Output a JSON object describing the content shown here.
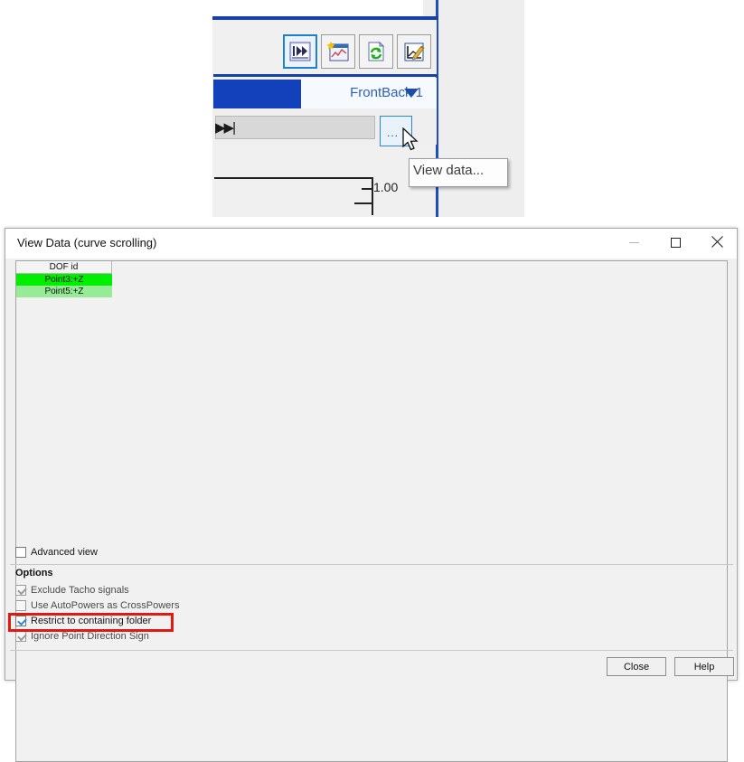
{
  "background_app": {
    "toolbar": {
      "buttons": [
        {
          "name": "fast-forward-icon",
          "label": "Fast forward",
          "selected": true
        },
        {
          "name": "new-chart-icon",
          "label": "New chart",
          "selected": false
        },
        {
          "name": "refresh-icon",
          "label": "Refresh",
          "selected": false
        },
        {
          "name": "edit-chart-icon",
          "label": "Edit chart",
          "selected": false
        }
      ]
    },
    "tab": {
      "label": "FrontBack 1",
      "caret_icon": "chevron-down-icon"
    },
    "control_row": {
      "fast_forward_icon": "skip-end-icon",
      "ellipsis_button_label": "...",
      "field_value": ""
    },
    "tooltip": {
      "text": "View data..."
    },
    "chart": {
      "axis_value_label": "1.00"
    },
    "cursor_icon": "mouse-pointer-icon"
  },
  "dialog": {
    "title": "View Data (curve scrolling)",
    "window_buttons": {
      "minimize": {
        "name": "minimize-icon",
        "label": "Minimize",
        "disabled": true
      },
      "maximize": {
        "name": "maximize-icon",
        "label": "Maximize",
        "disabled": false
      },
      "close": {
        "name": "close-icon",
        "label": "Close",
        "disabled": false
      }
    },
    "list": {
      "column_header": "DOF id",
      "rows": [
        {
          "dof_id": "Point3:+Z",
          "highlight": "#00ee00"
        },
        {
          "dof_id": "Point5:+Z",
          "highlight": "#96ec96"
        }
      ]
    },
    "advanced_view": {
      "label": "Advanced view",
      "checked": false,
      "enabled": true
    },
    "options": {
      "title": "Options",
      "items": [
        {
          "label": "Exclude Tacho signals",
          "checked": true,
          "enabled": false,
          "highlighted": false
        },
        {
          "label": "Use AutoPowers as CrossPowers",
          "checked": false,
          "enabled": false,
          "highlighted": false
        },
        {
          "label": "Restrict to containing folder",
          "checked": true,
          "enabled": true,
          "highlighted": true
        },
        {
          "label": "Ignore Point Direction Sign",
          "checked": true,
          "enabled": false,
          "highlighted": false
        }
      ]
    },
    "footer": {
      "close_label": "Close",
      "help_label": "Help"
    },
    "annotation": {
      "highlight_color": "#e01a12"
    }
  }
}
